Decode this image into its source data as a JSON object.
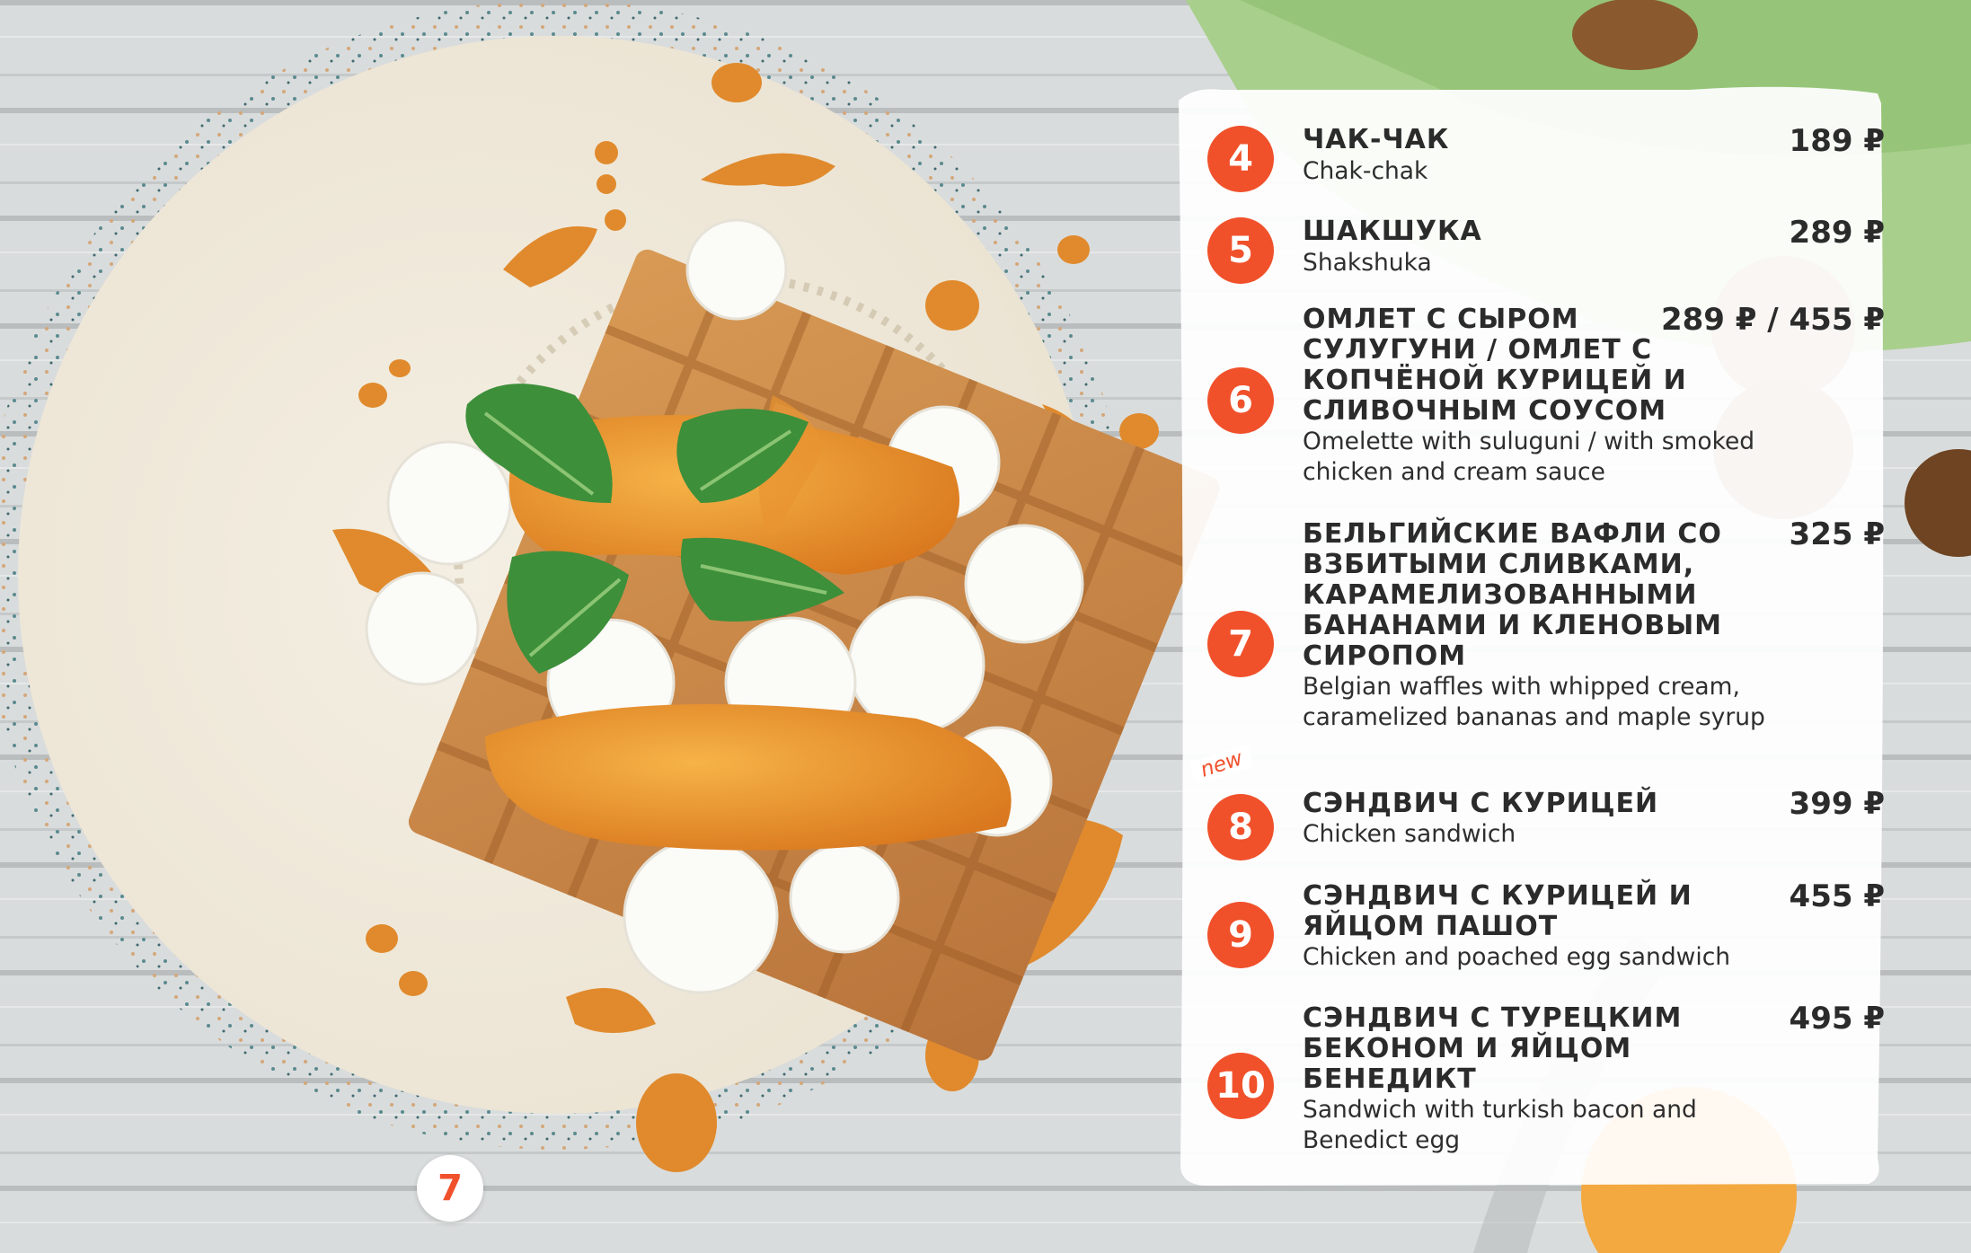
{
  "page": {
    "number": "7"
  },
  "colors": {
    "accent": "#f0512b",
    "text": "#2b2b2b",
    "panel": "#ffffff"
  },
  "menu": {
    "items": [
      {
        "num": "4",
        "title": "ЧАК-ЧАК",
        "sub": "Chak-chak",
        "price": "189 ₽"
      },
      {
        "num": "5",
        "title": "ШАКШУКА",
        "sub": "Shakshuka",
        "price": "289 ₽"
      },
      {
        "num": "6",
        "title": "ОМЛЕТ С СЫРОМ СУЛУГУНИ / ОМЛЕТ С КОПЧЁНОЙ КУРИЦЕЙ И СЛИВОЧНЫМ СОУСОМ",
        "sub": "Omelette with suluguni / with smoked chicken and cream sauce",
        "price": "289 ₽ / 455 ₽"
      },
      {
        "num": "7",
        "title": "БЕЛЬГИЙСКИЕ ВАФЛИ СО ВЗБИТЫМИ СЛИВКАМИ, КАРАМЕЛИЗОВАННЫМИ БАНАНАМИ И КЛЕНОВЫМ СИРОПОМ",
        "sub": "Belgian waffles with whipped cream, caramelized bananas and maple syrup",
        "price": "325 ₽"
      },
      {
        "num": "8",
        "badge": "new",
        "title": "СЭНДВИЧ С КУРИЦЕЙ",
        "sub": "Chicken sandwich",
        "price": "399 ₽"
      },
      {
        "num": "9",
        "title": "СЭНДВИЧ С КУРИЦЕЙ И ЯЙЦОМ ПАШОТ",
        "sub": "Chicken and poached egg sandwich",
        "price": "455 ₽"
      },
      {
        "num": "10",
        "title": "СЭНДВИЧ С ТУРЕЦКИМ БЕКОНОМ И ЯЙЦОМ БЕНЕДИКТ",
        "sub": "Sandwich with turkish bacon and Benedict egg",
        "price": "495 ₽"
      }
    ]
  }
}
